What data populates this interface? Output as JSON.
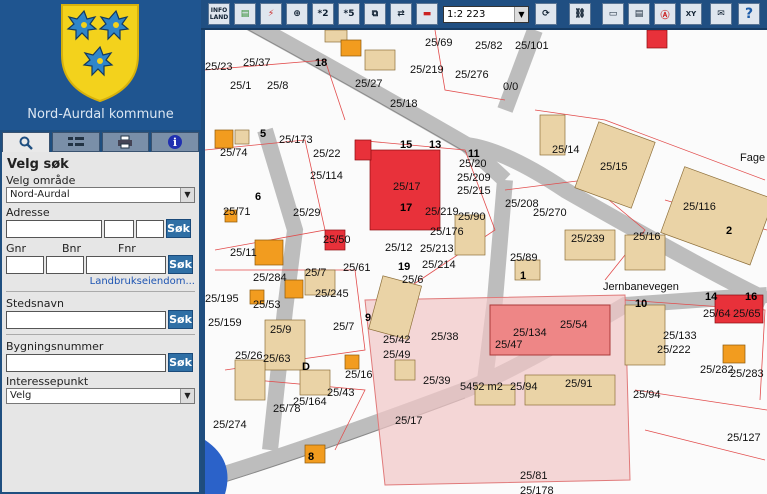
{
  "branding": {
    "municipality": "Nord-Aurdal kommune"
  },
  "tabs": [
    {
      "icon": "search-icon",
      "active": true
    },
    {
      "icon": "layers-icon"
    },
    {
      "icon": "print-icon"
    },
    {
      "icon": "info-icon"
    }
  ],
  "search": {
    "title": "Velg søk",
    "area_label": "Velg område",
    "area_value": "Nord-Aurdal",
    "address_label": "Adresse",
    "gnr_label": "Gnr",
    "bnr_label": "Bnr",
    "fnr_label": "Fnr",
    "land_link": "Landbrukseiendom...",
    "place_label": "Stedsnavn",
    "building_label": "Bygningsnummer",
    "poi_label": "Interessepunkt",
    "poi_value": "Velg",
    "search_btn": "Søk"
  },
  "toolbar": {
    "info_label": "INFO LAND",
    "zoom2": "*2",
    "zoom5": "*5",
    "scale": "1:2 223"
  },
  "map": {
    "labels": [
      "25/69",
      "25/82",
      "25/101",
      "25/23",
      "25/37",
      "27",
      "18",
      "25/219",
      "25/276",
      "0/0",
      "25/1",
      "25/8",
      "25/27",
      "25/18",
      "25/74",
      "5",
      "25/173",
      "25/22",
      "15",
      "13",
      "11",
      "25/20",
      "25/209",
      "25/215",
      "25/114",
      "25/17",
      "25/14",
      "25/15",
      "Fage",
      "25/116",
      "25/71",
      "25/29",
      "25/270",
      "25/208",
      "25/219",
      "25/90",
      "25/176",
      "25/213",
      "25/214",
      "25/50",
      "25/12",
      "25/239",
      "25/16",
      "25/89",
      "25/11",
      "25/284",
      "25/7",
      "25/245",
      "25/61",
      "25/6",
      "Jernbanevegen",
      "25/195",
      "25/159",
      "25/53",
      "25/9",
      "25/7",
      "25/134",
      "25/54",
      "25/64",
      "25/65",
      "25/133",
      "25/222",
      "25/47",
      "25/42",
      "25/49",
      "25/38",
      "25/26",
      "25/63",
      "25/39",
      "25/43",
      "25/16",
      "5452 m2",
      "25/94",
      "25/91",
      "25/164",
      "25/78",
      "25/94",
      "25/282",
      "25/283",
      "25/274",
      "25/17",
      "25/127",
      "25/81",
      "25/178"
    ]
  }
}
